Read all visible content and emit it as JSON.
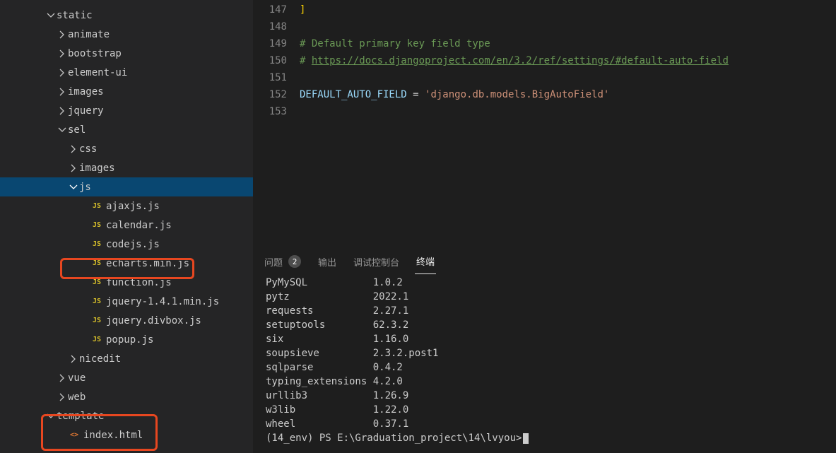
{
  "tree": {
    "static_label": "static",
    "animate": "animate",
    "bootstrap": "bootstrap",
    "element_ui": "element-ui",
    "images": "images",
    "jquery": "jquery",
    "sel": "sel",
    "sel_css": "css",
    "sel_images": "images",
    "sel_js": "js",
    "js_files": {
      "ajaxjs": "ajaxjs.js",
      "calendar": "calendar.js",
      "codejs": "codejs.js",
      "echarts": "echarts.min.js",
      "function": "function.js",
      "jquery141": "jquery-1.4.1.min.js",
      "divbox": "jquery.divbox.js",
      "popup": "popup.js"
    },
    "nicedit": "nicedit",
    "vue": "vue",
    "web": "web",
    "template": "template",
    "index_html": "index.html"
  },
  "code": {
    "l147_num": "147",
    "l147_txt": "]",
    "l148_num": "148",
    "l149_num": "149",
    "l149_txt": "# Default primary key field type",
    "l150_num": "150",
    "l150_a": "# ",
    "l150_b": "https://docs.djangoproject.com/en/3.2/ref/settings/#default-auto-field",
    "l151_num": "151",
    "l152_num": "152",
    "l152_var": "DEFAULT_AUTO_FIELD",
    "l152_eq": " = ",
    "l152_str": "'django.db.models.BigAutoField'",
    "l153_num": "153"
  },
  "panel": {
    "tabs": {
      "problems": "问题",
      "problems_count": "2",
      "output": "输出",
      "debug": "调试控制台",
      "terminal": "终端"
    },
    "terminal_lines": [
      "PyMySQL           1.0.2",
      "pytz              2022.1",
      "requests          2.27.1",
      "setuptools        62.3.2",
      "six               1.16.0",
      "soupsieve         2.3.2.post1",
      "sqlparse          0.4.2",
      "typing_extensions 4.2.0",
      "urllib3           1.26.9",
      "w3lib             1.22.0",
      "wheel             0.37.1"
    ],
    "prompt": "(14_env) PS E:\\Graduation_project\\14\\lvyou>"
  },
  "js_badge": "JS",
  "html_badge": "<>"
}
